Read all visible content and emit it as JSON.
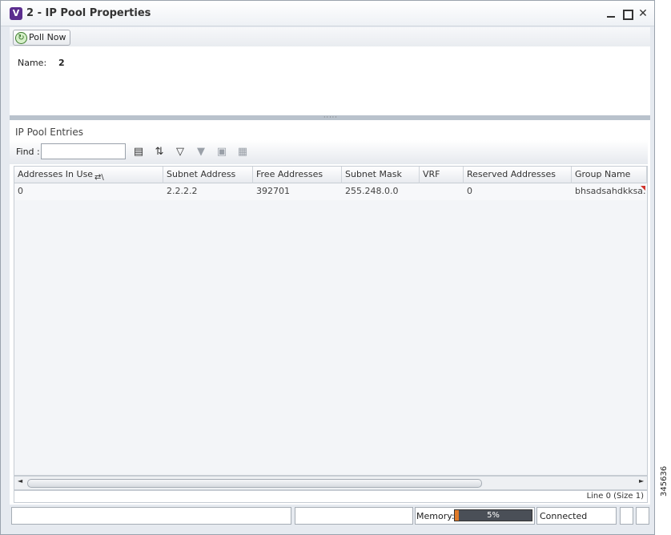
{
  "window": {
    "title": "2 - IP Pool Properties",
    "app_icon_letter": "V"
  },
  "toolbar": {
    "poll_label": "Poll Now"
  },
  "properties": {
    "name_label": "Name:",
    "name_value": "2"
  },
  "entries": {
    "section_title": "IP Pool Entries",
    "find_label": "Find :",
    "find_value": "",
    "columns": [
      "Addresses In Use",
      "Subnet Address",
      "Free Addresses",
      "Subnet Mask",
      "VRF",
      "Reserved Addresses",
      "Group Name"
    ],
    "rows": [
      [
        "0",
        "2.2.2.2",
        "392701",
        "255.248.0.0",
        "",
        "0",
        "bhsadsahdkksa..."
      ]
    ],
    "line_status": "Line 0 (Size 1)"
  },
  "statusbar": {
    "memory_label": "Memory:",
    "memory_percent": 5,
    "memory_text": "5%",
    "connection": "Connected"
  },
  "side_id": "345636",
  "colors": {
    "accent": "#5b2d8e",
    "memory_fill": "#e07a28"
  }
}
